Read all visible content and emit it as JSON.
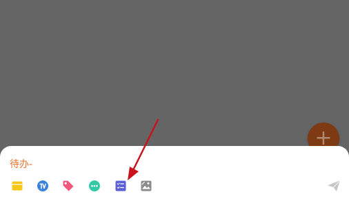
{
  "composer": {
    "input_value": "待办-"
  },
  "toolbar": {
    "icons": [
      "folder-icon",
      "tv-icon",
      "tag-icon",
      "more-icon",
      "checklist-icon",
      "image-icon"
    ],
    "send_icon": "send-icon"
  },
  "fab": {
    "icon": "plus-icon",
    "label": "+"
  },
  "colors": {
    "overlay": "#656565",
    "input_text": "#e8732a",
    "fab_background": "#7e3a12",
    "folder_icon": "#f7c61a",
    "tv_icon": "#3a82db",
    "tag_icon": "#f0577a",
    "more_icon": "#34c9a6",
    "checklist_icon": "#5c5fd6",
    "image_icon": "#8c8c8c",
    "send_icon": "#c7c7c7",
    "annotation_arrow": "#c8141a"
  }
}
